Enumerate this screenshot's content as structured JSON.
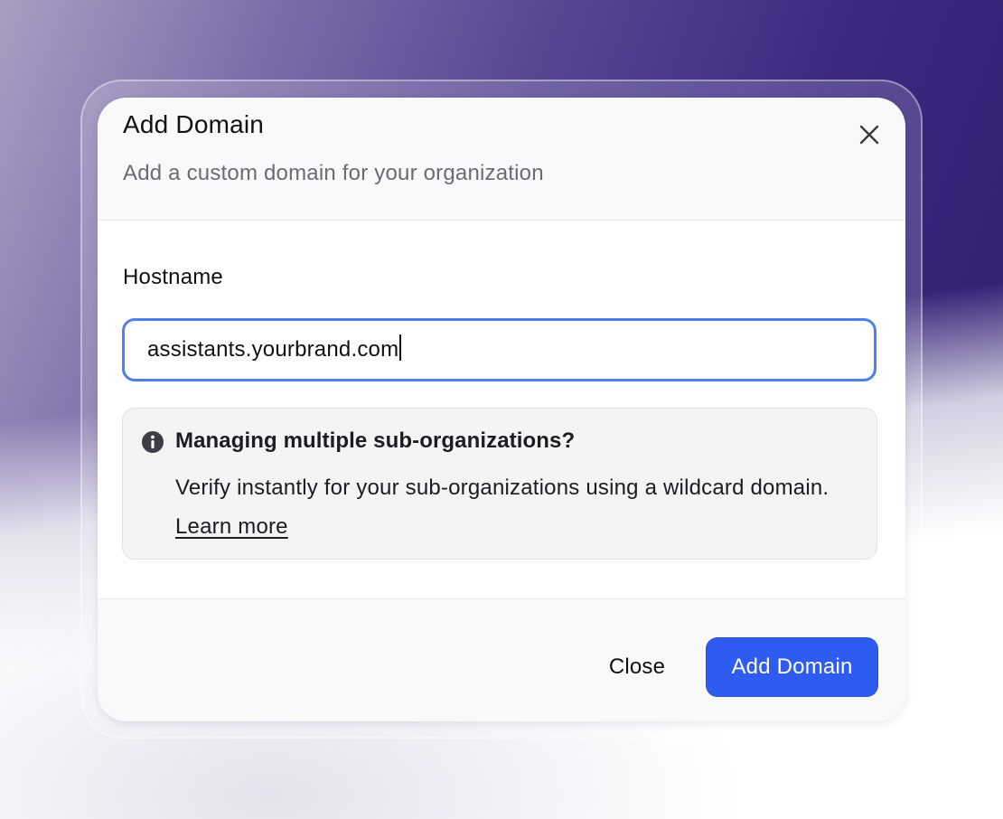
{
  "modal": {
    "title": "Add Domain",
    "subtitle": "Add a custom domain for your organization",
    "close_icon": "close-icon"
  },
  "form": {
    "hostname_label": "Hostname",
    "hostname_value": "assistants.yourbrand.com"
  },
  "notice": {
    "icon": "info-icon",
    "title": "Managing multiple sub-organizations?",
    "text": "Verify instantly for your sub-organizations using a wildcard domain.",
    "link": "Learn more"
  },
  "footer": {
    "close_label": "Close",
    "add_label": "Add Domain"
  },
  "colors": {
    "primary": "#2f5cf0",
    "focus_border": "#4f7fea",
    "background_purple": "#2c1a6b"
  }
}
